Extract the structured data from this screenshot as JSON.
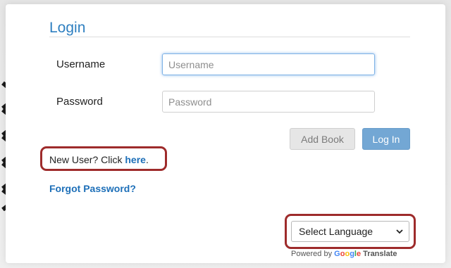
{
  "login": {
    "title": "Login",
    "username_label": "Username",
    "username_placeholder": "Username",
    "username_value": "",
    "password_label": "Password",
    "password_placeholder": "Password",
    "password_value": "",
    "add_book_label": "Add Book",
    "login_button_label": "Log In"
  },
  "links": {
    "new_user_prefix": "New User? Click ",
    "new_user_link": "here",
    "new_user_suffix": ".",
    "forgot_password": "Forgot Password?"
  },
  "translate": {
    "selected_language": "Select Language",
    "powered_by": "Powered by ",
    "google": [
      "G",
      "o",
      "o",
      "g",
      "l",
      "e"
    ],
    "google_colors": [
      "#4285F4",
      "#EA4335",
      "#FBBC05",
      "#4285F4",
      "#34A853",
      "#EA4335"
    ],
    "translate_label": "Translate"
  },
  "colors": {
    "title": "#2e7fc0",
    "link": "#1d6fb8",
    "login_button": "#73a7d4",
    "highlight": "#9e2b2b"
  }
}
